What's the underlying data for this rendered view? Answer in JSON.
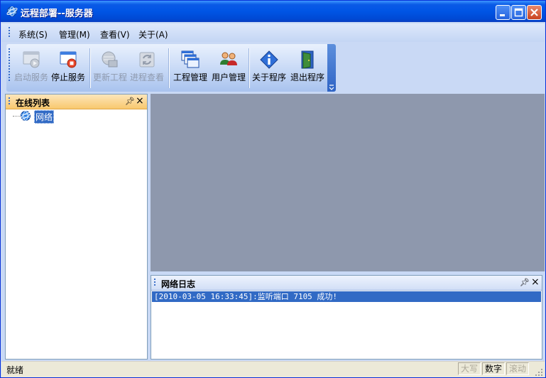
{
  "window": {
    "title": "远程部署--服务器"
  },
  "menu": [
    {
      "label": "系统(S)"
    },
    {
      "label": "管理(M)"
    },
    {
      "label": "查看(V)"
    },
    {
      "label": "关于(A)"
    }
  ],
  "toolbar": {
    "start_service": "启动服务",
    "stop_service": "停止服务",
    "update_project": "更新工程",
    "process_view": "进程查看",
    "project_manage": "工程管理",
    "user_manage": "用户管理",
    "about_program": "关于程序",
    "exit_program": "退出程序"
  },
  "online_panel": {
    "title": "在线列表",
    "tree_root": "网络"
  },
  "log_panel": {
    "title": "网络日志",
    "lines": [
      "[2010-03-05 16:33:45]:监听端口 7105 成功!"
    ]
  },
  "status": {
    "text": "就绪",
    "caps": "大写",
    "num": "数字",
    "scroll": "滚动"
  },
  "colors": {
    "title_bar": "#0055e5",
    "panel_active": "#f8c86e",
    "selection": "#316ac5",
    "mdi_background": "#8e98ad"
  }
}
